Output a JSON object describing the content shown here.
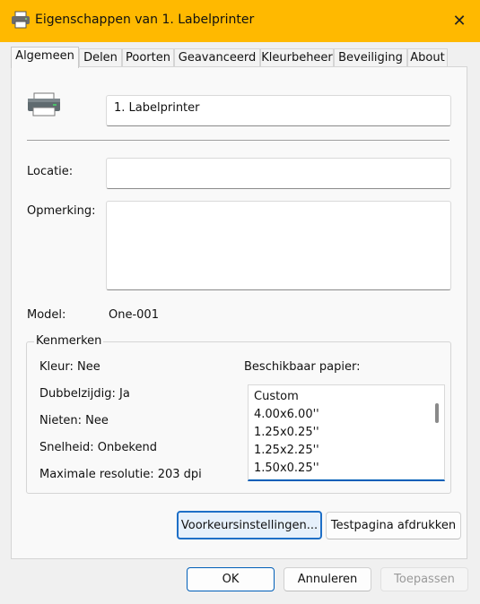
{
  "window": {
    "title": "Eigenschappen van 1. Labelprinter",
    "close_glyph": "✕"
  },
  "tabs": [
    {
      "label": "Algemeen",
      "active": true
    },
    {
      "label": "Delen"
    },
    {
      "label": "Poorten"
    },
    {
      "label": "Geavanceerd"
    },
    {
      "label": "Kleurbeheer"
    },
    {
      "label": "Beveiliging"
    },
    {
      "label": "About"
    }
  ],
  "general": {
    "printer_name": "1. Labelprinter",
    "location_label": "Locatie:",
    "location_value": "",
    "comment_label": "Opmerking:",
    "comment_value": "",
    "model_label": "Model:",
    "model_value": "One-001"
  },
  "features": {
    "legend": "Kenmerken",
    "color": "Kleur: Nee",
    "duplex": "Dubbelzijdig: Ja",
    "staple": "Nieten: Nee",
    "speed": "Snelheid: Onbekend",
    "max_resolution": "Maximale resolutie: 203 dpi",
    "paper_label": "Beschikbaar papier:",
    "paper_sizes": [
      "Custom",
      "4.00x6.00''",
      "1.25x0.25''",
      "1.25x2.25''",
      "1.50x0.25''"
    ]
  },
  "buttons": {
    "preferences": "Voorkeursinstellingen...",
    "test_page": "Testpagina afdrukken",
    "ok": "OK",
    "cancel": "Annuleren",
    "apply": "Toepassen"
  },
  "colors": {
    "titlebar": "#ffb900",
    "accent": "#005fb8"
  },
  "icons": {
    "app": "printer-icon",
    "printer": "printer-icon",
    "close": "close-icon"
  }
}
